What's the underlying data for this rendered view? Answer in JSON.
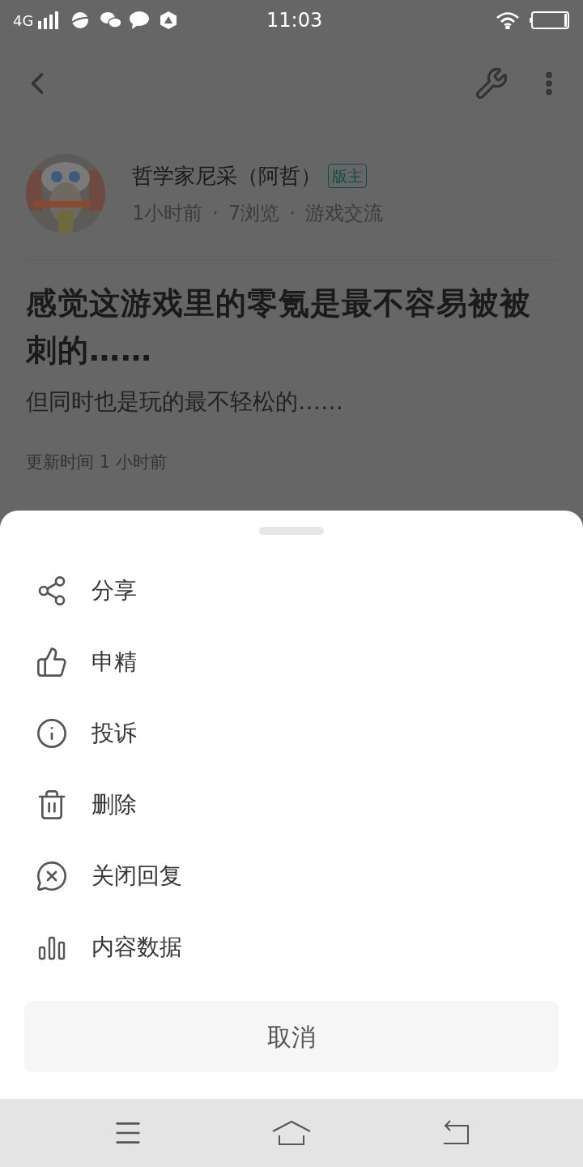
{
  "status_bar": {
    "network": "4G",
    "time": "11:03"
  },
  "post": {
    "author": "哲学家尼采（阿哲）",
    "badge": "版主",
    "meta": [
      "1小时前",
      "·",
      "7浏览",
      "·",
      "游戏交流"
    ],
    "title": "感觉这游戏里的零氪是最不容易被被刺的……",
    "body": "但同时也是玩的最不轻松的……",
    "updated": "更新时间 1 小时前"
  },
  "sheet": {
    "items": [
      {
        "kind": "share",
        "label": "分享"
      },
      {
        "kind": "recommend",
        "label": "申精"
      },
      {
        "kind": "report",
        "label": "投诉"
      },
      {
        "kind": "delete",
        "label": "删除"
      },
      {
        "kind": "close_replies",
        "label": "关闭回复"
      },
      {
        "kind": "stats",
        "label": "内容数据"
      }
    ],
    "cancel": "取消"
  }
}
